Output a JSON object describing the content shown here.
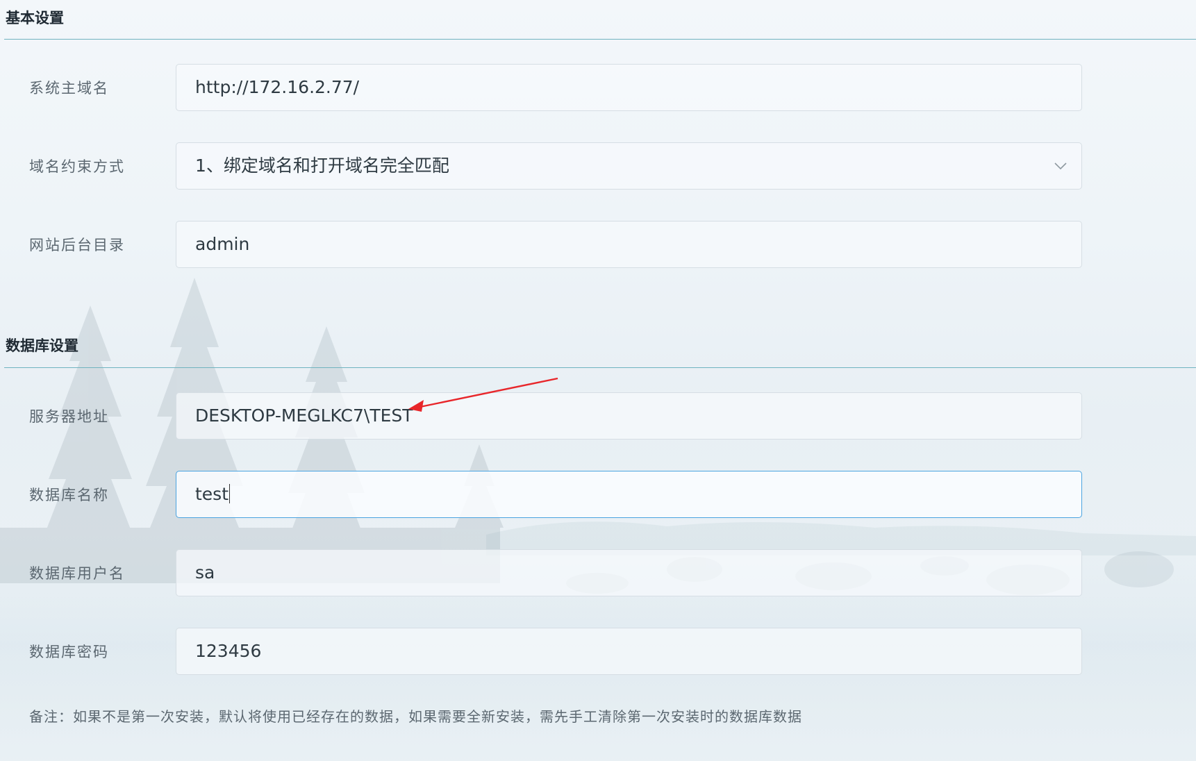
{
  "basic_section": {
    "title": "基本设置",
    "fields": [
      {
        "label": "系统主域名",
        "value": "http://172.16.2.77/"
      },
      {
        "label": "域名约束方式",
        "value": "1、绑定域名和打开域名完全匹配"
      },
      {
        "label": "网站后台目录",
        "value": "admin"
      }
    ]
  },
  "database_section": {
    "title": "数据库设置",
    "fields": [
      {
        "label": "服务器地址",
        "value": "DESKTOP-MEGLKC7\\TEST"
      },
      {
        "label": "数据库名称",
        "value": "test"
      },
      {
        "label": "数据库用户名",
        "value": "sa"
      },
      {
        "label": "数据库密码",
        "value": "123456"
      }
    ]
  },
  "note": "备注：如果不是第一次安装，默认将使用已经存在的数据，如果需要全新安装，需先手工清除第一次安装时的数据库数据",
  "icons": {
    "select_chevron": "chevron-down-icon",
    "annotation": "red-arrow"
  },
  "colors": {
    "section_line": "#6fb3bf",
    "active_border": "#4aa3e0",
    "annotation_arrow": "#e8262a"
  }
}
